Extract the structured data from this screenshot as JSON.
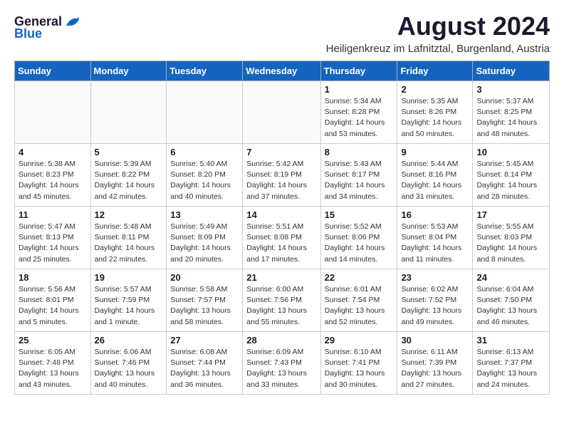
{
  "logo": {
    "general": "General",
    "blue": "Blue"
  },
  "title": "August 2024",
  "subtitle": "Heiligenkreuz im Lafnitztal, Burgenland, Austria",
  "days_of_week": [
    "Sunday",
    "Monday",
    "Tuesday",
    "Wednesday",
    "Thursday",
    "Friday",
    "Saturday"
  ],
  "weeks": [
    [
      {
        "day": "",
        "info": ""
      },
      {
        "day": "",
        "info": ""
      },
      {
        "day": "",
        "info": ""
      },
      {
        "day": "",
        "info": ""
      },
      {
        "day": "1",
        "info": "Sunrise: 5:34 AM\nSunset: 8:28 PM\nDaylight: 14 hours\nand 53 minutes."
      },
      {
        "day": "2",
        "info": "Sunrise: 5:35 AM\nSunset: 8:26 PM\nDaylight: 14 hours\nand 50 minutes."
      },
      {
        "day": "3",
        "info": "Sunrise: 5:37 AM\nSunset: 8:25 PM\nDaylight: 14 hours\nand 48 minutes."
      }
    ],
    [
      {
        "day": "4",
        "info": "Sunrise: 5:38 AM\nSunset: 8:23 PM\nDaylight: 14 hours\nand 45 minutes."
      },
      {
        "day": "5",
        "info": "Sunrise: 5:39 AM\nSunset: 8:22 PM\nDaylight: 14 hours\nand 42 minutes."
      },
      {
        "day": "6",
        "info": "Sunrise: 5:40 AM\nSunset: 8:20 PM\nDaylight: 14 hours\nand 40 minutes."
      },
      {
        "day": "7",
        "info": "Sunrise: 5:42 AM\nSunset: 8:19 PM\nDaylight: 14 hours\nand 37 minutes."
      },
      {
        "day": "8",
        "info": "Sunrise: 5:43 AM\nSunset: 8:17 PM\nDaylight: 14 hours\nand 34 minutes."
      },
      {
        "day": "9",
        "info": "Sunrise: 5:44 AM\nSunset: 8:16 PM\nDaylight: 14 hours\nand 31 minutes."
      },
      {
        "day": "10",
        "info": "Sunrise: 5:45 AM\nSunset: 8:14 PM\nDaylight: 14 hours\nand 28 minutes."
      }
    ],
    [
      {
        "day": "11",
        "info": "Sunrise: 5:47 AM\nSunset: 8:13 PM\nDaylight: 14 hours\nand 25 minutes."
      },
      {
        "day": "12",
        "info": "Sunrise: 5:48 AM\nSunset: 8:11 PM\nDaylight: 14 hours\nand 22 minutes."
      },
      {
        "day": "13",
        "info": "Sunrise: 5:49 AM\nSunset: 8:09 PM\nDaylight: 14 hours\nand 20 minutes."
      },
      {
        "day": "14",
        "info": "Sunrise: 5:51 AM\nSunset: 8:08 PM\nDaylight: 14 hours\nand 17 minutes."
      },
      {
        "day": "15",
        "info": "Sunrise: 5:52 AM\nSunset: 8:06 PM\nDaylight: 14 hours\nand 14 minutes."
      },
      {
        "day": "16",
        "info": "Sunrise: 5:53 AM\nSunset: 8:04 PM\nDaylight: 14 hours\nand 11 minutes."
      },
      {
        "day": "17",
        "info": "Sunrise: 5:55 AM\nSunset: 8:03 PM\nDaylight: 14 hours\nand 8 minutes."
      }
    ],
    [
      {
        "day": "18",
        "info": "Sunrise: 5:56 AM\nSunset: 8:01 PM\nDaylight: 14 hours\nand 5 minutes."
      },
      {
        "day": "19",
        "info": "Sunrise: 5:57 AM\nSunset: 7:59 PM\nDaylight: 14 hours\nand 1 minute."
      },
      {
        "day": "20",
        "info": "Sunrise: 5:58 AM\nSunset: 7:57 PM\nDaylight: 13 hours\nand 58 minutes."
      },
      {
        "day": "21",
        "info": "Sunrise: 6:00 AM\nSunset: 7:56 PM\nDaylight: 13 hours\nand 55 minutes."
      },
      {
        "day": "22",
        "info": "Sunrise: 6:01 AM\nSunset: 7:54 PM\nDaylight: 13 hours\nand 52 minutes."
      },
      {
        "day": "23",
        "info": "Sunrise: 6:02 AM\nSunset: 7:52 PM\nDaylight: 13 hours\nand 49 minutes."
      },
      {
        "day": "24",
        "info": "Sunrise: 6:04 AM\nSunset: 7:50 PM\nDaylight: 13 hours\nand 46 minutes."
      }
    ],
    [
      {
        "day": "25",
        "info": "Sunrise: 6:05 AM\nSunset: 7:48 PM\nDaylight: 13 hours\nand 43 minutes."
      },
      {
        "day": "26",
        "info": "Sunrise: 6:06 AM\nSunset: 7:46 PM\nDaylight: 13 hours\nand 40 minutes."
      },
      {
        "day": "27",
        "info": "Sunrise: 6:08 AM\nSunset: 7:44 PM\nDaylight: 13 hours\nand 36 minutes."
      },
      {
        "day": "28",
        "info": "Sunrise: 6:09 AM\nSunset: 7:43 PM\nDaylight: 13 hours\nand 33 minutes."
      },
      {
        "day": "29",
        "info": "Sunrise: 6:10 AM\nSunset: 7:41 PM\nDaylight: 13 hours\nand 30 minutes."
      },
      {
        "day": "30",
        "info": "Sunrise: 6:11 AM\nSunset: 7:39 PM\nDaylight: 13 hours\nand 27 minutes."
      },
      {
        "day": "31",
        "info": "Sunrise: 6:13 AM\nSunset: 7:37 PM\nDaylight: 13 hours\nand 24 minutes."
      }
    ]
  ]
}
